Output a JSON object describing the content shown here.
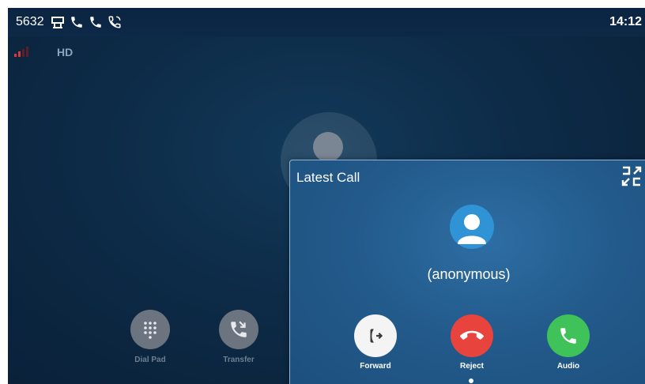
{
  "status_bar": {
    "extension": "5632",
    "icons": [
      "desk-phone-icon",
      "phone-icon",
      "phone-icon",
      "phone-ringing-icon"
    ],
    "time": "14:12"
  },
  "call_info": {
    "signal_icon": "signal-bars-icon",
    "quality": "HD"
  },
  "background_actions": [
    {
      "label": "Dial Pad",
      "icon": "dialpad-icon"
    },
    {
      "label": "Transfer",
      "icon": "transfer-icon"
    }
  ],
  "popup": {
    "title": "Latest Call",
    "collapse_icon": "collapse-icon",
    "caller_name": "(anonymous)",
    "actions": [
      {
        "label": "Forward",
        "icon": "forward-icon",
        "color": "#f4f4f4"
      },
      {
        "label": "Reject",
        "icon": "hang-up-icon",
        "color": "#e8433d"
      },
      {
        "label": "Audio",
        "icon": "answer-call-icon",
        "color": "#3fc25a"
      }
    ]
  },
  "colors": {
    "background": "#0d2b47",
    "popup": "#235b8c",
    "reject": "#e8433d",
    "answer": "#3fc25a"
  }
}
